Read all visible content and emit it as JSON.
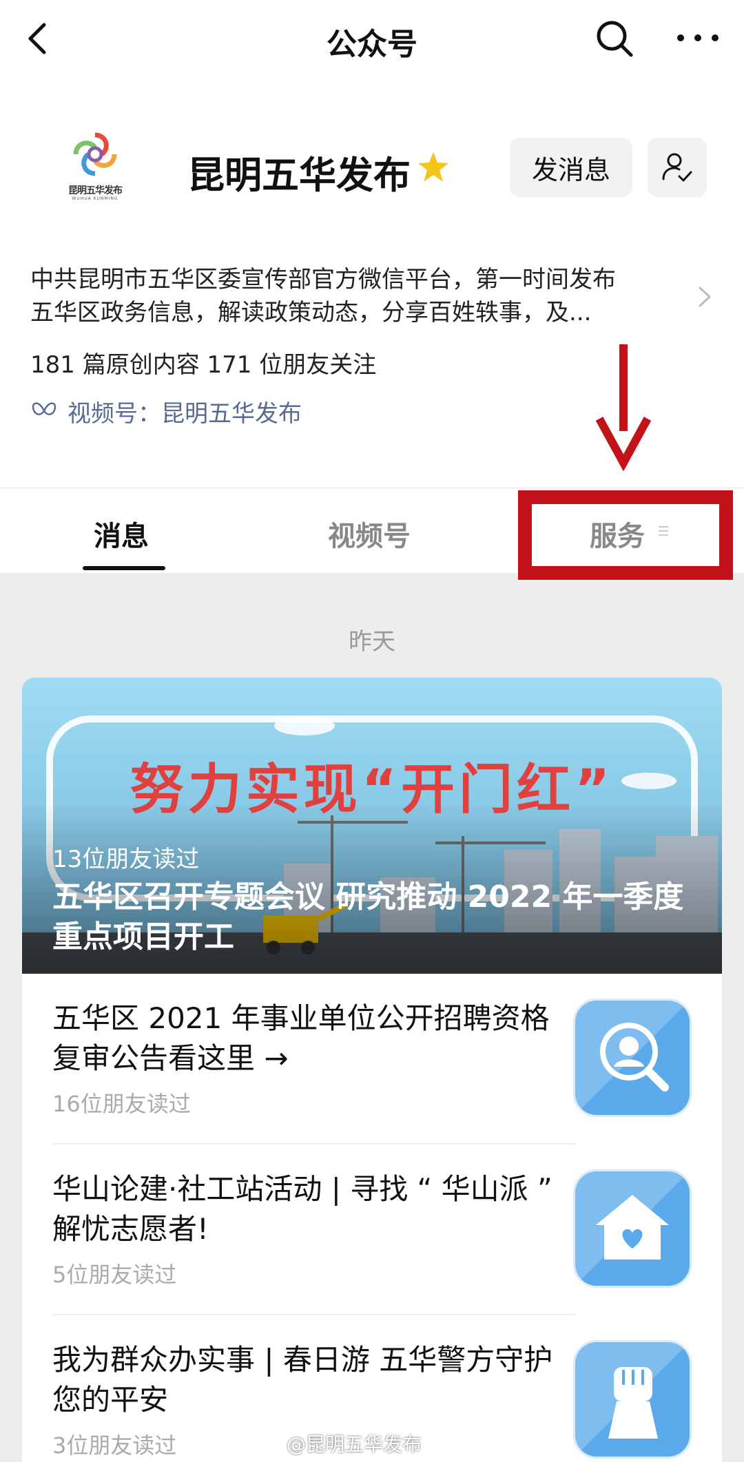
{
  "nav": {
    "title": "公众号"
  },
  "profile": {
    "name": "昆明五华发布",
    "logo_text": "昆明五华发布",
    "logo_subtext": "WUHUA KUNMING",
    "message_button": "发消息",
    "description_line1": "中共昆明市五华区委宣传部官方微信平台，第一时间发布",
    "description_line2": "五华区政务信息，解读政策动态，分享百姓轶事，及...",
    "stats": "181 篇原创内容  171 位朋友关注",
    "channel": "视频号：昆明五华发布"
  },
  "tabs": [
    {
      "label": "消息",
      "active": true
    },
    {
      "label": "视频号",
      "active": false
    },
    {
      "label": "服务",
      "active": false
    }
  ],
  "feed": {
    "date": "昨天",
    "banner": {
      "slogan": "努力实现“开门红”",
      "read_count": "13位朋友读过",
      "title": "五华区召开专题会议 研究推动 2022 年一季度重点项目开工"
    },
    "articles": [
      {
        "title": "五华区 2021 年事业单位公开招聘资格复审公告看这里 →",
        "read_count": "16位朋友读过",
        "thumb_icon": "magnifier-person-icon"
      },
      {
        "title": "华山论建·社工站活动 | 寻找 “ 华山派 ” 解忧志愿者!",
        "read_count": "5位朋友读过",
        "thumb_icon": "house-heart-icon"
      },
      {
        "title": "我为群众办实事 | 春日游 五华警方守护您的平安",
        "read_count": "3位朋友读过",
        "thumb_icon": "fist-icon"
      }
    ]
  },
  "watermark": "@昆明五华发布",
  "colors": {
    "annotation_red": "#c4121a",
    "link_blue": "#576b95",
    "star_yellow": "#f5c518",
    "banner_sky": "#8fd1ee",
    "thumb_blue": "#5aa9ea"
  }
}
